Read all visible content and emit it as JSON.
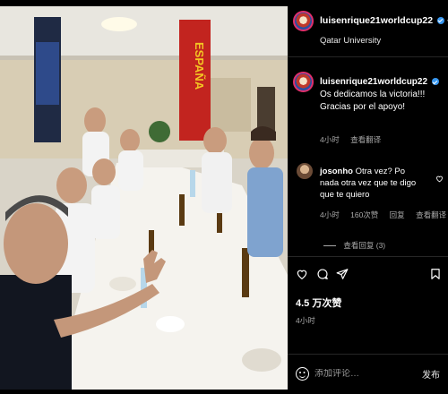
{
  "header": {
    "username": "luisenrique21worldcup22",
    "follow_label": "关",
    "location": "Qatar University"
  },
  "caption": {
    "username": "luisenrique21worldcup22",
    "text": "Os dedicamos la victoria!!! Gracias por el apoyo!",
    "time": "4小时",
    "translate_label": "查看翻译"
  },
  "comment": {
    "username": "josonho",
    "text": "Otra vez? Po nada otra vez que te digo que te quiero",
    "time": "4小时",
    "likes": "160次赞",
    "reply_label": "回复",
    "translate_label": "查看翻译",
    "view_replies": "查看回复 (3)"
  },
  "actions": {
    "likes": "4.5 万次赞",
    "time": "4小时"
  },
  "add_comment": {
    "placeholder": "添加评论…",
    "post_label": "发布"
  },
  "photo": {
    "banner_text": "ESPAÑA"
  },
  "colors": {
    "background": "#000000",
    "verified": "#3897f0",
    "muted_text": "#a8a8a8",
    "divider": "#262626"
  }
}
